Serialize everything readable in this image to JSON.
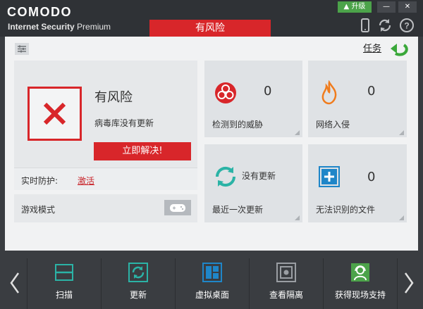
{
  "app": {
    "brand": "COMODO",
    "subtitle_bold": "Internet Security",
    "subtitle_light": " Premium",
    "risk_tab": "有风险",
    "upgrade": "升级",
    "minimize": "—",
    "close": "✕"
  },
  "toolbar": {
    "task_link": "任务"
  },
  "status": {
    "title": "有风险",
    "message": "病毒库没有更新",
    "fix_button": "立即解决!",
    "realtime_label": "实时防护:",
    "realtime_link": "激活",
    "game_mode_label": "游戏模式"
  },
  "tiles": [
    {
      "label": "检测到的威胁",
      "value": "0"
    },
    {
      "label": "网络入侵",
      "value": "0"
    },
    {
      "label": "最近一次更新",
      "value": "没有更新"
    },
    {
      "label": "无法识别的文件",
      "value": "0"
    }
  ],
  "bottom": {
    "items": [
      {
        "label": "扫描"
      },
      {
        "label": "更新"
      },
      {
        "label": "虚拟桌面"
      },
      {
        "label": "查看隔离"
      },
      {
        "label": "获得现场支持"
      }
    ]
  },
  "colors": {
    "accent_red": "#d8262a",
    "green": "#4ca34a",
    "teal": "#2bb3a6",
    "blue": "#1f86c8",
    "orange": "#f07c1d"
  }
}
